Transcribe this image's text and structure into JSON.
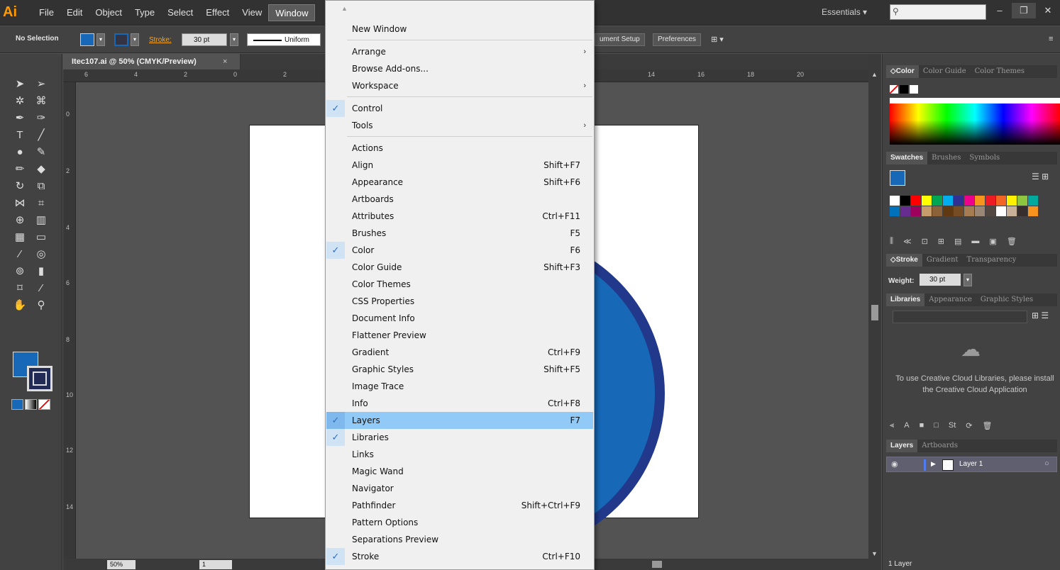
{
  "app": {
    "logo": "Ai"
  },
  "menubar": {
    "items": [
      "File",
      "Edit",
      "Object",
      "Type",
      "Select",
      "Effect",
      "View",
      "Window"
    ],
    "workspace_label": "Essentials"
  },
  "controlbar": {
    "selection_label": "No Selection",
    "stroke_label": "Stroke:",
    "stroke_weight": "30 pt",
    "profile_label": "Uniform",
    "document_setup_label": "ument Setup",
    "preferences_label": "Preferences"
  },
  "document": {
    "tab_title": "Itec107.ai @ 50% (CMYK/Preview)",
    "close_glyph": "×",
    "ruler_h_labels": [
      "6",
      "4",
      "2",
      "0",
      "2",
      "14",
      "16",
      "18",
      "20"
    ],
    "ruler_v_labels": [
      "0",
      "2",
      "4",
      "6",
      "8",
      "10",
      "12",
      "14"
    ],
    "zoom": "50%",
    "page": "1"
  },
  "window_menu": {
    "items": [
      {
        "label": "New Window",
        "shortcut": "",
        "checked": false,
        "submenu": false,
        "highlighted": false
      },
      {
        "label": "Arrange",
        "shortcut": "",
        "checked": false,
        "submenu": true,
        "highlighted": false
      },
      {
        "label": "Browse Add-ons...",
        "shortcut": "",
        "checked": false,
        "submenu": false,
        "highlighted": false
      },
      {
        "label": "Workspace",
        "shortcut": "",
        "checked": false,
        "submenu": true,
        "highlighted": false
      },
      {
        "label": "Control",
        "shortcut": "",
        "checked": true,
        "submenu": false,
        "highlighted": false
      },
      {
        "label": "Tools",
        "shortcut": "",
        "checked": false,
        "submenu": true,
        "highlighted": false
      },
      {
        "label": "Actions",
        "shortcut": "",
        "checked": false,
        "submenu": false,
        "highlighted": false
      },
      {
        "label": "Align",
        "shortcut": "Shift+F7",
        "checked": false,
        "submenu": false,
        "highlighted": false
      },
      {
        "label": "Appearance",
        "shortcut": "Shift+F6",
        "checked": false,
        "submenu": false,
        "highlighted": false
      },
      {
        "label": "Artboards",
        "shortcut": "",
        "checked": false,
        "submenu": false,
        "highlighted": false
      },
      {
        "label": "Attributes",
        "shortcut": "Ctrl+F11",
        "checked": false,
        "submenu": false,
        "highlighted": false
      },
      {
        "label": "Brushes",
        "shortcut": "F5",
        "checked": false,
        "submenu": false,
        "highlighted": false
      },
      {
        "label": "Color",
        "shortcut": "F6",
        "checked": true,
        "submenu": false,
        "highlighted": false
      },
      {
        "label": "Color Guide",
        "shortcut": "Shift+F3",
        "checked": false,
        "submenu": false,
        "highlighted": false
      },
      {
        "label": "Color Themes",
        "shortcut": "",
        "checked": false,
        "submenu": false,
        "highlighted": false
      },
      {
        "label": "CSS Properties",
        "shortcut": "",
        "checked": false,
        "submenu": false,
        "highlighted": false
      },
      {
        "label": "Document Info",
        "shortcut": "",
        "checked": false,
        "submenu": false,
        "highlighted": false
      },
      {
        "label": "Flattener Preview",
        "shortcut": "",
        "checked": false,
        "submenu": false,
        "highlighted": false
      },
      {
        "label": "Gradient",
        "shortcut": "Ctrl+F9",
        "checked": false,
        "submenu": false,
        "highlighted": false
      },
      {
        "label": "Graphic Styles",
        "shortcut": "Shift+F5",
        "checked": false,
        "submenu": false,
        "highlighted": false
      },
      {
        "label": "Image Trace",
        "shortcut": "",
        "checked": false,
        "submenu": false,
        "highlighted": false
      },
      {
        "label": "Info",
        "shortcut": "Ctrl+F8",
        "checked": false,
        "submenu": false,
        "highlighted": false
      },
      {
        "label": "Layers",
        "shortcut": "F7",
        "checked": true,
        "submenu": false,
        "highlighted": true
      },
      {
        "label": "Libraries",
        "shortcut": "",
        "checked": true,
        "submenu": false,
        "highlighted": false
      },
      {
        "label": "Links",
        "shortcut": "",
        "checked": false,
        "submenu": false,
        "highlighted": false
      },
      {
        "label": "Magic Wand",
        "shortcut": "",
        "checked": false,
        "submenu": false,
        "highlighted": false
      },
      {
        "label": "Navigator",
        "shortcut": "",
        "checked": false,
        "submenu": false,
        "highlighted": false
      },
      {
        "label": "Pathfinder",
        "shortcut": "Shift+Ctrl+F9",
        "checked": false,
        "submenu": false,
        "highlighted": false
      },
      {
        "label": "Pattern Options",
        "shortcut": "",
        "checked": false,
        "submenu": false,
        "highlighted": false
      },
      {
        "label": "Separations Preview",
        "shortcut": "",
        "checked": false,
        "submenu": false,
        "highlighted": false
      },
      {
        "label": "Stroke",
        "shortcut": "Ctrl+F10",
        "checked": true,
        "submenu": false,
        "highlighted": false
      }
    ]
  },
  "panels": {
    "color_tabs": [
      "◇Color",
      "Color Guide",
      "Color Themes"
    ],
    "swatch_tabs": [
      "Swatches",
      "Brushes",
      "Symbols"
    ],
    "stroke_tabs": [
      "◇Stroke",
      "Gradient",
      "Transparency"
    ],
    "stroke_weight_label": "Weight:",
    "stroke_weight_value": "30 pt",
    "library_tabs": [
      "Libraries",
      "Appearance",
      "Graphic Styles"
    ],
    "library_message": "To use Creative Cloud Libraries, please install the Creative Cloud Application",
    "layer_tabs": [
      "Layers",
      "Artboards"
    ],
    "layer_name": "Layer 1",
    "layer_count": "1 Layer"
  },
  "colors": {
    "fill": "#1769b8",
    "stroke": "#22388a",
    "highlight": "#91c9f7",
    "swatches": [
      "#ffffff",
      "#000000",
      "#ff0000",
      "#ffff00",
      "#00a651",
      "#00aeef",
      "#2e3192",
      "#ec008c",
      "#f7941d",
      "#ed1c24",
      "#f26522",
      "#fff200",
      "#8dc63f",
      "#00a99d",
      "#0072bc",
      "#662d91",
      "#9e005d",
      "#c69c6d",
      "#8c6239",
      "#603913",
      "#754c24",
      "#a67c52",
      "#998675",
      "#534741",
      "#ffffff",
      "#c7b299",
      "#362f2d",
      "#f7941d"
    ]
  }
}
